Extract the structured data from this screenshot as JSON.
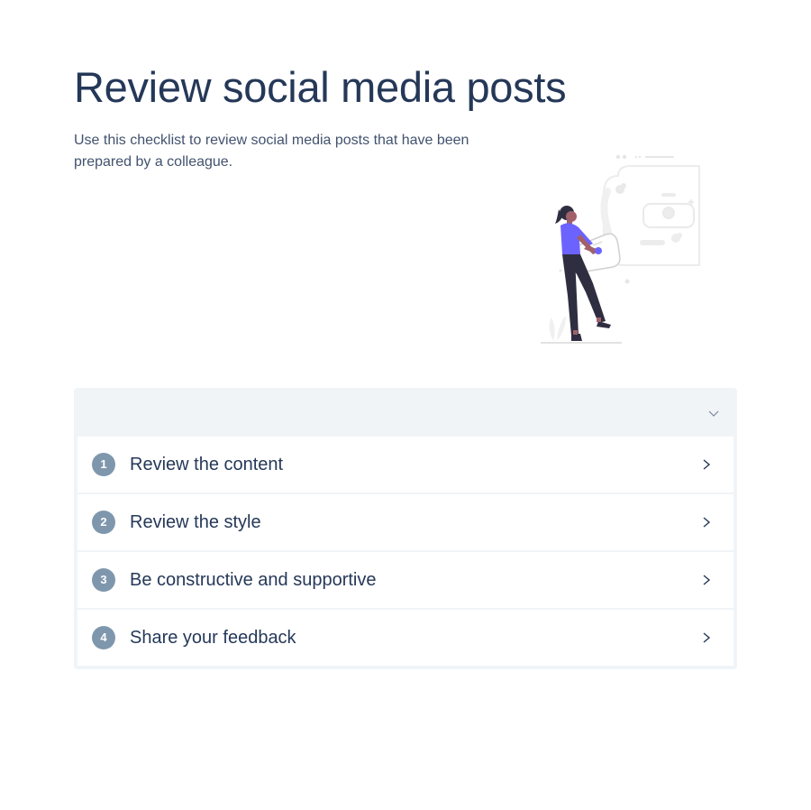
{
  "page": {
    "title": "Review social media posts",
    "description": "Use this checklist to review social media posts that have been prepared by a colleague."
  },
  "illustration": {
    "icon": "woman-holding-speech-bubble-illustration",
    "accent_color": "#6c63ff"
  },
  "checklist": {
    "toggle_icon": "chevron-down-icon",
    "items": [
      {
        "number": "1",
        "label": "Review the content"
      },
      {
        "number": "2",
        "label": "Review the style"
      },
      {
        "number": "3",
        "label": "Be constructive and supportive"
      },
      {
        "number": "4",
        "label": "Share your feedback"
      }
    ],
    "item_icon": "chevron-right-icon",
    "number_badge_color": "#7f97ad",
    "panel_color": "#f1f4f7"
  }
}
